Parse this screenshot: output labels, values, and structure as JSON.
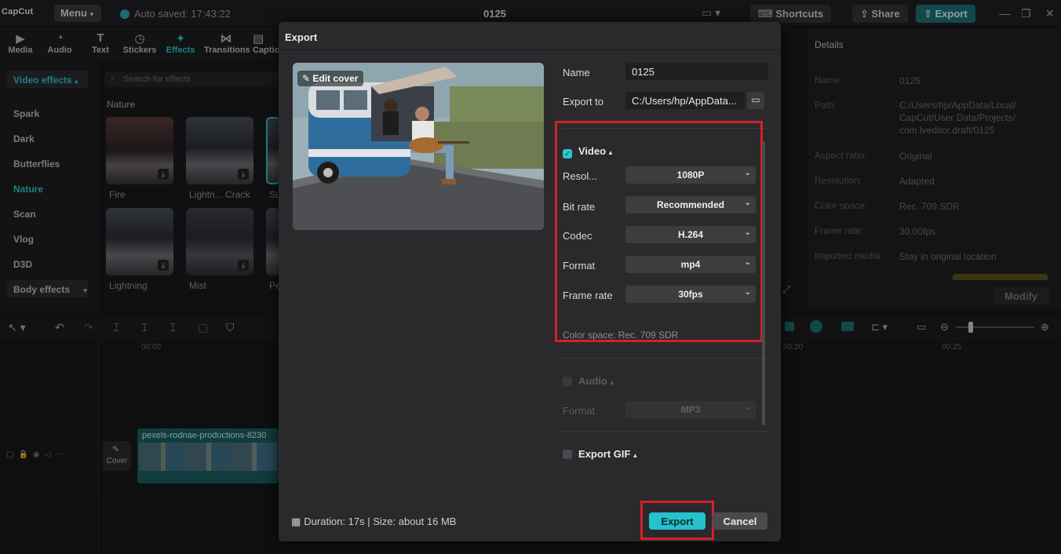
{
  "app": {
    "logo": "CapCut",
    "menu_label": "Menu",
    "autosave": "Auto saved: 17:43:22",
    "project_title": "0125",
    "shortcuts_label": "Shortcuts",
    "share_label": "Share",
    "export_label": "Export"
  },
  "tabs": [
    {
      "label": "Media",
      "icon": "media-icon"
    },
    {
      "label": "Audio",
      "icon": "audio-icon"
    },
    {
      "label": "Text",
      "icon": "text-icon"
    },
    {
      "label": "Stickers",
      "icon": "sticker-icon"
    },
    {
      "label": "Effects",
      "icon": "effects-icon"
    },
    {
      "label": "Transitions",
      "icon": "transitions-icon"
    },
    {
      "label": "Captio",
      "icon": "captions-icon"
    }
  ],
  "effects": {
    "video_effects_label": "Video effects",
    "categories": [
      "Spark",
      "Dark",
      "Butterflies",
      "Nature",
      "Scan",
      "Vlog",
      "D3D"
    ],
    "active_category": "Nature",
    "body_effects_label": "Body effects",
    "search_placeholder": "Search for effects",
    "section_label": "Nature",
    "items": [
      "Fire",
      "Lightn... Crack",
      "Su",
      "Lightning",
      "Mist",
      "Pe"
    ]
  },
  "timeline": {
    "ruler": [
      "00:00",
      "00:20",
      "00:25"
    ],
    "clip_name": "pexels-rodnae-productions-8230",
    "cover_label": "Cover"
  },
  "details": {
    "title": "Details",
    "rows": [
      {
        "key": "Name:",
        "value": "0125"
      },
      {
        "key": "Path:",
        "value": "C:/Users/hp/AppData/Local/ CapCut/User Data/Projects/ com.lveditor.draft/0125"
      },
      {
        "key": "Aspect ratio:",
        "value": "Original"
      },
      {
        "key": "Resolution:",
        "value": "Adapted"
      },
      {
        "key": "Color space:",
        "value": "Rec. 709 SDR"
      },
      {
        "key": "Frame rate:",
        "value": "30.00fps"
      },
      {
        "key": "Imported media:",
        "value": "Stay in original location"
      }
    ],
    "modify_label": "Modify"
  },
  "export_dialog": {
    "title": "Export",
    "edit_cover_label": "Edit cover",
    "name_label": "Name",
    "name_value": "0125",
    "export_to_label": "Export to",
    "export_to_value": "C:/Users/hp/AppData...",
    "video": {
      "label": "Video",
      "checked": true,
      "resolution_label": "Resol...",
      "resolution_value": "1080P",
      "bitrate_label": "Bit rate",
      "bitrate_value": "Recommended",
      "codec_label": "Codec",
      "codec_value": "H.264",
      "format_label": "Format",
      "format_value": "mp4",
      "framerate_label": "Frame rate",
      "framerate_value": "30fps",
      "color_space": "Color space: Rec. 709 SDR"
    },
    "audio": {
      "label": "Audio",
      "checked": false,
      "format_label": "Format",
      "format_value": "MP3"
    },
    "gif": {
      "label": "Export GIF",
      "checked": false
    },
    "duration": "Duration: 17s | Size: about 16 MB",
    "export_button": "Export",
    "cancel_button": "Cancel"
  },
  "colors": {
    "accent": "#2bc6d0",
    "highlight_box": "#d4202a",
    "dialog_bg": "#2a2a2c"
  }
}
